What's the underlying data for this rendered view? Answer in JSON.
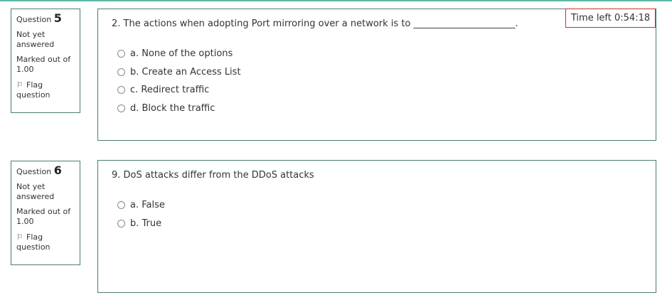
{
  "timer": {
    "label": "Time left 0:54:18"
  },
  "questions": [
    {
      "label": "Question",
      "number": "5",
      "state": "Not yet answered",
      "marks": "Marked out of 1.00",
      "flag_label": "Flag question",
      "text": "2. The actions when adopting Port mirroring over a network is to ______________________.",
      "options": [
        "a. None of the options",
        "b. Create an Access List",
        "c. Redirect traffic",
        "d. Block the traffic"
      ]
    },
    {
      "label": "Question",
      "number": "6",
      "state": "Not yet answered",
      "marks": "Marked out of 1.00",
      "flag_label": "Flag question",
      "text": "9. DoS attacks differ from the DDoS attacks",
      "options": [
        "a. False",
        "b. True"
      ]
    }
  ]
}
